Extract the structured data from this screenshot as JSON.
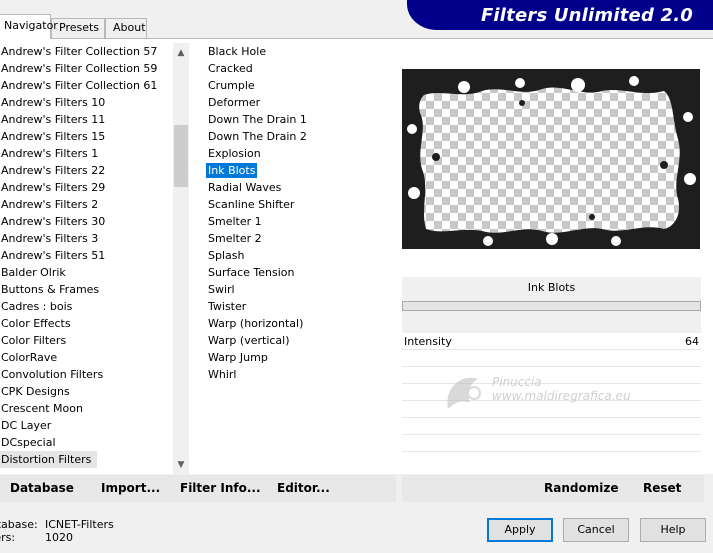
{
  "tabs": [
    "Navigator",
    "Presets",
    "About"
  ],
  "banner": "Filters Unlimited 2.0",
  "categories": [
    "Andrew's Filter Collection 57",
    "Andrew's Filter Collection 59",
    "Andrew's Filter Collection 61",
    "Andrew's Filters 10",
    "Andrew's Filters 11",
    "Andrew's Filters 15",
    "Andrew's Filters 1",
    "Andrew's Filters 22",
    "Andrew's Filters 29",
    "Andrew's Filters 2",
    "Andrew's Filters 30",
    "Andrew's Filters 3",
    "Andrew's Filters 51",
    "Balder Olrik",
    "Buttons & Frames",
    "Cadres : bois",
    "Color Effects",
    "Color Filters",
    "ColorRave",
    "Convolution Filters",
    "CPK Designs",
    "Crescent Moon",
    "DC Layer",
    "DCspecial",
    "Distortion Filters"
  ],
  "selected_category": "Distortion Filters",
  "filters": [
    "Black Hole",
    "Cracked",
    "Crumple",
    "Deformer",
    "Down The Drain 1",
    "Down The Drain 2",
    "Explosion",
    "Ink Blots",
    "Radial Waves",
    "Scanline Shifter",
    "Smelter 1",
    "Smelter 2",
    "Splash",
    "Surface Tension",
    "Swirl",
    "Twister",
    "Warp (horizontal)",
    "Warp (vertical)",
    "Warp Jump",
    "Whirl"
  ],
  "selected_filter": "Ink Blots",
  "params": {
    "filter_name": "Ink Blots",
    "rows": [
      {
        "label": "Intensity",
        "value": "64"
      }
    ]
  },
  "watermark": {
    "line1": "Pinuccia",
    "line2": "www.maldiregrafica.eu"
  },
  "bottom_left": {
    "database": "Database",
    "import": "Import...",
    "filter_info": "Filter Info...",
    "editor": "Editor..."
  },
  "bottom_right": {
    "randomize": "Randomize",
    "reset": "Reset"
  },
  "info": {
    "database_label": "atabase:",
    "database_value": "ICNET-Filters",
    "filters_label": "ters:",
    "filters_value": "1020"
  },
  "buttons": {
    "apply": "Apply",
    "cancel": "Cancel",
    "help": "Help"
  },
  "colors": {
    "banner": "#00008b",
    "selection": "#0078d7"
  }
}
